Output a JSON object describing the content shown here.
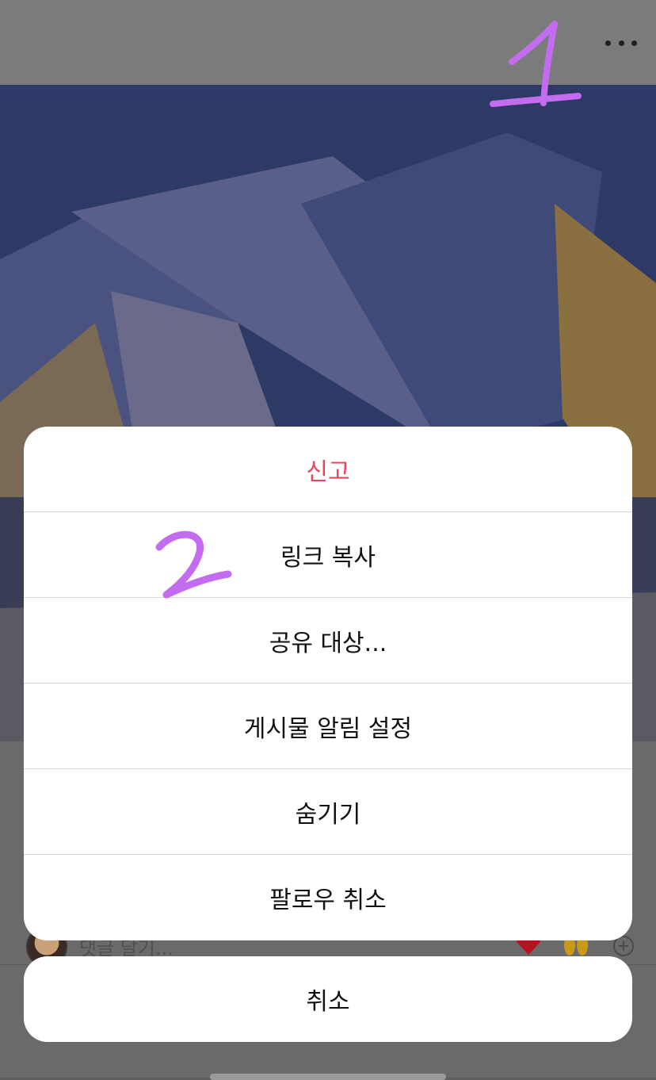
{
  "header": {
    "more_icon": "more-horizontal-icon"
  },
  "comment_bar": {
    "placeholder": "댓글 달기...",
    "icons": [
      "heart-emoji",
      "raised-hands-emoji",
      "plus-circle-icon"
    ]
  },
  "action_sheet": {
    "items": [
      {
        "label": "신고",
        "style": "destructive"
      },
      {
        "label": "링크 복사",
        "style": "default"
      },
      {
        "label": "공유 대상...",
        "style": "default"
      },
      {
        "label": "게시물 알림 설정",
        "style": "default"
      },
      {
        "label": "숨기기",
        "style": "default"
      },
      {
        "label": "팔로우 취소",
        "style": "default"
      }
    ],
    "cancel_label": "취소"
  },
  "colors": {
    "destructive": "#e8465a",
    "annotation": "#c46cf0"
  }
}
